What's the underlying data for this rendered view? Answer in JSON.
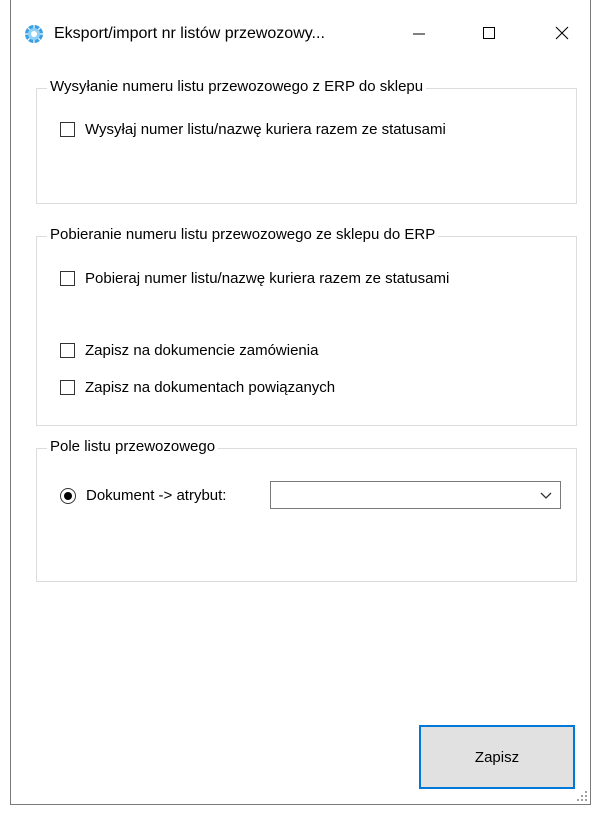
{
  "window": {
    "title": "Eksport/import nr listów przewozowy...",
    "controls": [
      "minimize",
      "maximize",
      "close"
    ]
  },
  "send_group": {
    "title": "Wysyłanie numeru listu przewozowego z ERP do sklepu",
    "checkbox_send": {
      "label": "Wysyłaj numer listu/nazwę kuriera razem ze statusami",
      "checked": false
    }
  },
  "fetch_group": {
    "title": "Pobieranie numeru listu przewozowego ze sklepu do ERP",
    "checkbox_fetch": {
      "label": "Pobieraj numer listu/nazwę kuriera razem ze statusami",
      "checked": false
    },
    "checkbox_order_doc": {
      "label": "Zapisz na dokumencie zamówienia",
      "checked": false
    },
    "checkbox_related_docs": {
      "label": "Zapisz na dokumentach powiązanych",
      "checked": false
    }
  },
  "field_group": {
    "title": "Pole listu przewozowego",
    "radio_document_attr": {
      "label": "Dokument -> atrybut:",
      "selected": true
    },
    "attribute_select": {
      "value": ""
    }
  },
  "buttons": {
    "save_label": "Zapisz"
  },
  "colors": {
    "accent": "#0078d7",
    "button_bg": "#e1e1e1",
    "group_border": "#dcdcdc"
  }
}
